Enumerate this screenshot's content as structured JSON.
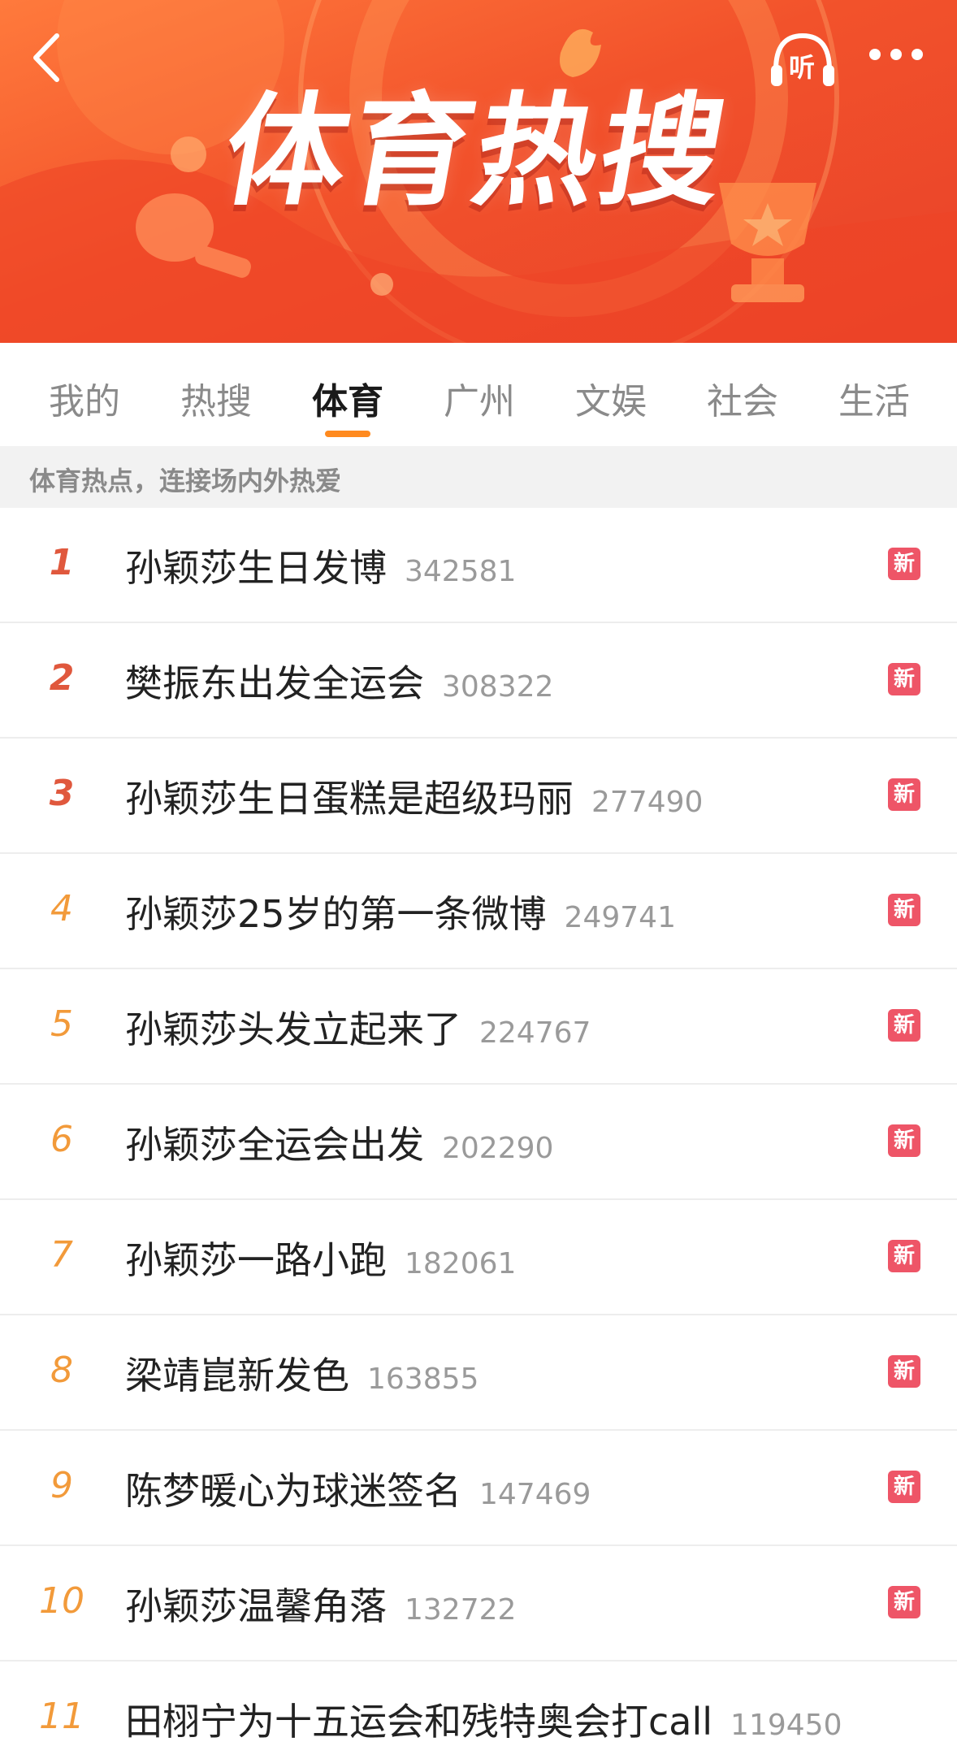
{
  "header": {
    "title": "体育热搜",
    "listen_label": "听"
  },
  "tabs": [
    {
      "label": "我的"
    },
    {
      "label": "热搜"
    },
    {
      "label": "体育"
    },
    {
      "label": "广州"
    },
    {
      "label": "文娱"
    },
    {
      "label": "社会"
    },
    {
      "label": "生活"
    }
  ],
  "section": {
    "subtitle": "体育热点，连接场内外热爱"
  },
  "list": [
    {
      "rank": "1",
      "title": "孙颖莎生日发博",
      "count": "342581",
      "badge": "新"
    },
    {
      "rank": "2",
      "title": "樊振东出发全运会",
      "count": "308322",
      "badge": "新"
    },
    {
      "rank": "3",
      "title": "孙颖莎生日蛋糕是超级玛丽",
      "count": "277490",
      "badge": "新"
    },
    {
      "rank": "4",
      "title": "孙颖莎25岁的第一条微博",
      "count": "249741",
      "badge": "新"
    },
    {
      "rank": "5",
      "title": "孙颖莎头发立起来了",
      "count": "224767",
      "badge": "新"
    },
    {
      "rank": "6",
      "title": "孙颖莎全运会出发",
      "count": "202290",
      "badge": "新"
    },
    {
      "rank": "7",
      "title": "孙颖莎一路小跑",
      "count": "182061",
      "badge": "新"
    },
    {
      "rank": "8",
      "title": "梁靖崑新发色",
      "count": "163855",
      "badge": "新"
    },
    {
      "rank": "9",
      "title": "陈梦暖心为球迷签名",
      "count": "147469",
      "badge": "新"
    },
    {
      "rank": "10",
      "title": "孙颖莎温馨角落",
      "count": "132722",
      "badge": "新"
    },
    {
      "rank": "11",
      "title": "田栩宁为十五运会和残特奥会打call",
      "count": "119450",
      "badge": ""
    }
  ],
  "colors": {
    "banner": "#f2522b",
    "rank_top": "#e0583d",
    "rank_other": "#f29a3a",
    "badge_new": "#ee5567",
    "tab_indicator": "#ff8a1f"
  }
}
